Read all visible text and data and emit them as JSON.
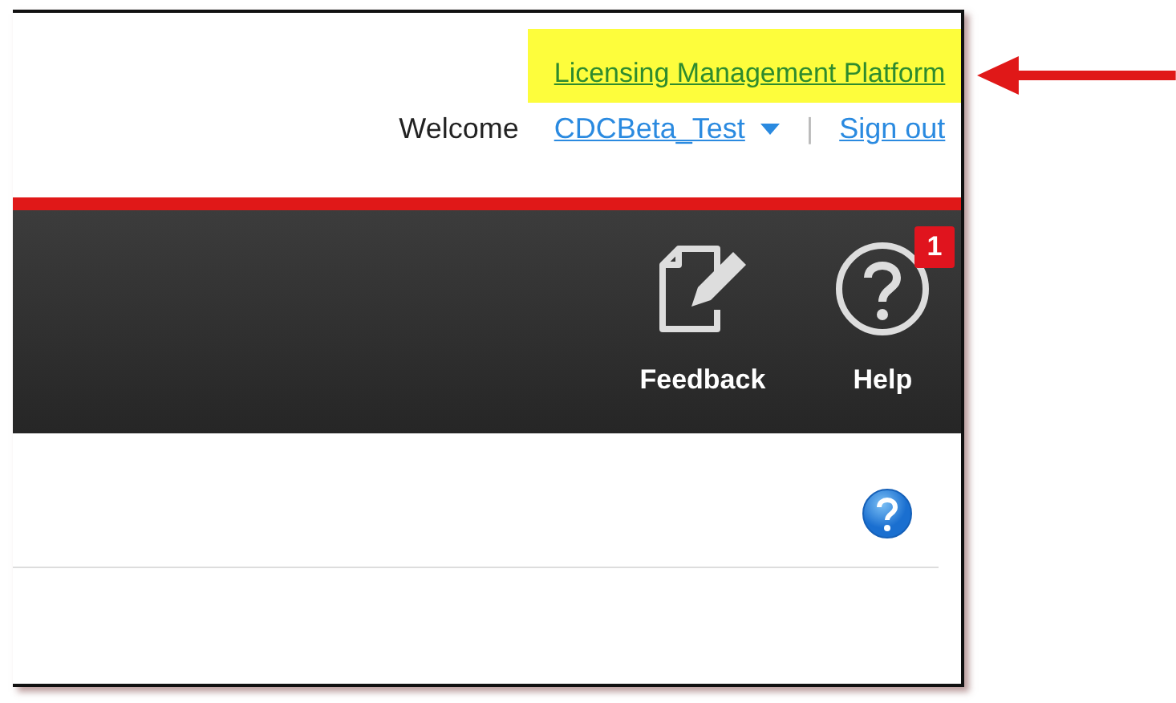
{
  "header": {
    "platform_link": "Licensing Management Platform",
    "highlighted": true,
    "welcome": "Welcome",
    "user": "CDCBeta_Test",
    "separator": "|",
    "sign_out": "Sign out"
  },
  "toolbar": {
    "items": [
      {
        "kind": "feedback",
        "label": "Feedback"
      },
      {
        "kind": "help",
        "label": "Help",
        "badge": "1"
      }
    ]
  }
}
